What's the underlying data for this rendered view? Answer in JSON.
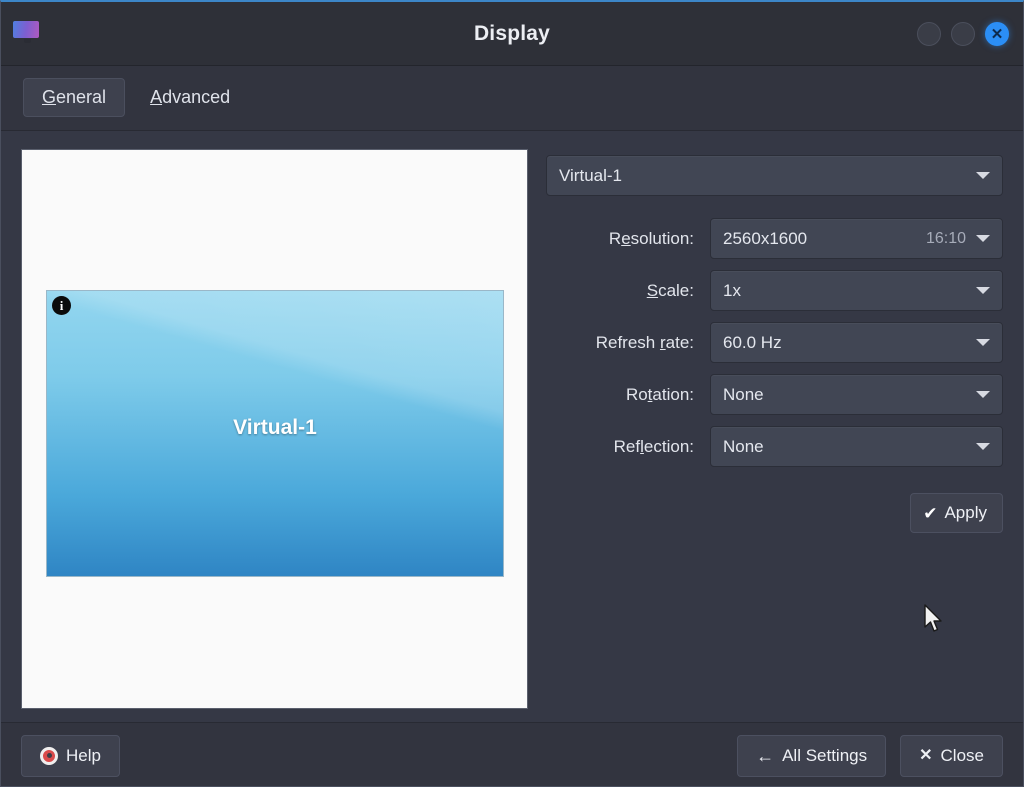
{
  "window": {
    "title": "Display",
    "app_icon": "monitor-icon",
    "controls": {
      "minimize": "minimize-button",
      "maximize": "maximize-button",
      "close_glyph": "✕",
      "close_color": "#2b8ef5"
    }
  },
  "tabs": [
    {
      "label": "General",
      "mnemonic": "G",
      "active": true
    },
    {
      "label": "Advanced",
      "mnemonic": "A",
      "active": false
    }
  ],
  "preview": {
    "monitor_label": "Virtual-1",
    "info_glyph": "i",
    "canvas_color": "#fafafa",
    "monitor_gradient_from": "#93d6ef",
    "monitor_gradient_to": "#2f85c4"
  },
  "form": {
    "output_select": {
      "value": "Virtual-1"
    },
    "fields": [
      {
        "label": "Resolution:",
        "mnemonic": "e",
        "value": "2560x1600",
        "extra": "16:10"
      },
      {
        "label": "Scale:",
        "mnemonic": "S",
        "value": "1x",
        "extra": ""
      },
      {
        "label": "Refresh rate:",
        "mnemonic": "r",
        "value": "60.0 Hz",
        "extra": ""
      },
      {
        "label": "Rotation:",
        "mnemonic": "t",
        "value": "None",
        "extra": ""
      },
      {
        "label": "Reflection:",
        "mnemonic": "l",
        "value": "None",
        "extra": ""
      }
    ],
    "apply_button": {
      "label": "Apply",
      "icon": "check-icon",
      "check_glyph": "✔"
    }
  },
  "footer": {
    "help_button": {
      "label": "Help",
      "icon": "lifebuoy-icon"
    },
    "all_settings_button": {
      "label": "All Settings",
      "icon": "arrow-left-icon",
      "arrow_glyph": "←"
    },
    "close_button": {
      "label": "Close",
      "icon": "close-x-icon",
      "x_glyph": "✕"
    }
  },
  "theme": {
    "window_bg": "#353845",
    "titlebar_bg": "#2e3038",
    "panel_bg": "#32343f",
    "field_bg": "#414654",
    "accent": "#2b8ef5",
    "text": "#e4e7ee"
  }
}
